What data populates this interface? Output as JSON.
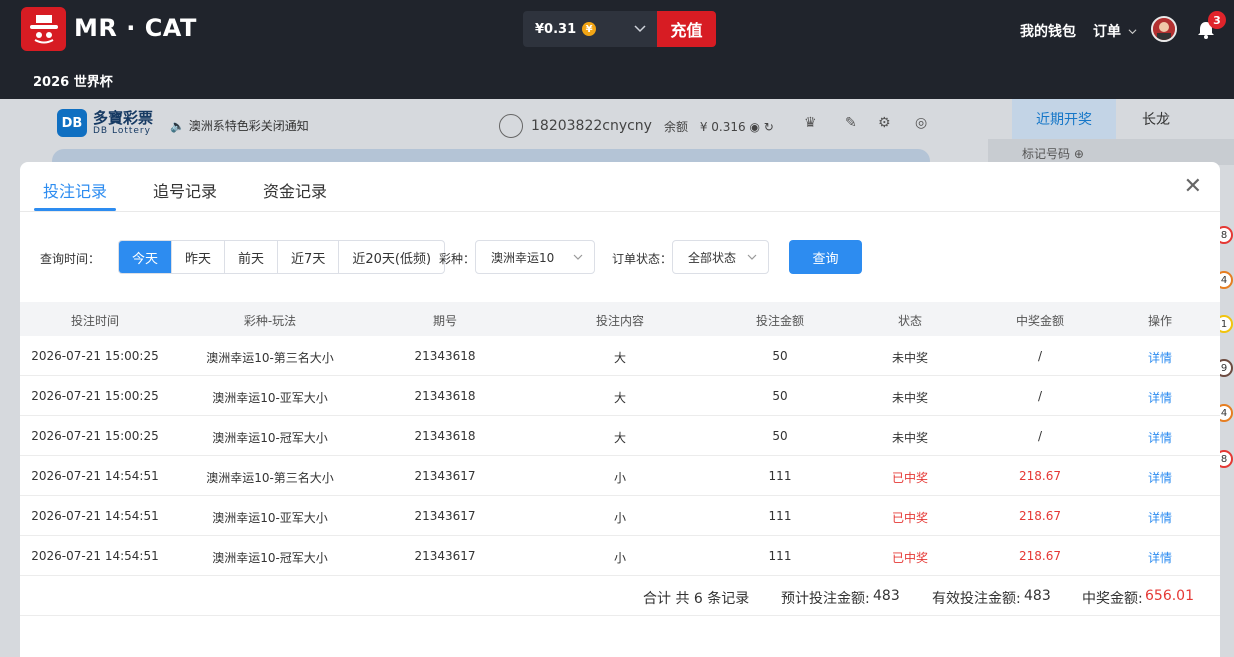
{
  "header": {
    "brand": "MR · CAT",
    "subtitle": "2026 世界杯",
    "balance": "¥0.31",
    "coin_symbol": "¥",
    "recharge": "充值",
    "wallet": "我的钱包",
    "orders": "订单",
    "notifications_count": "3"
  },
  "background": {
    "lottery_logo": "DB",
    "lottery_name": "多寶彩票",
    "lottery_sub": "DB Lottery",
    "notice": "澳洲系特色彩关闭通知",
    "username": "18203822cnycny",
    "balance_label": "余额",
    "balance_value": "¥ 0.316",
    "tab_recent": "近期开奖",
    "tab_long": "长龙",
    "mark_number": "标记号码",
    "balls": [
      "8",
      "4",
      "1",
      "9",
      "4",
      "8"
    ]
  },
  "modal": {
    "tabs": [
      "投注记录",
      "追号记录",
      "资金记录"
    ],
    "filters": {
      "time_label": "查询时间：",
      "time_options": [
        "今天",
        "昨天",
        "前天",
        "近7天",
        "近20天(低频)"
      ],
      "lottery_label": "彩种：",
      "lottery_value": "澳洲幸运10",
      "status_label": "订单状态：",
      "status_value": "全部状态",
      "query_button": "查询"
    },
    "columns": [
      "投注时间",
      "彩种-玩法",
      "期号",
      "投注内容",
      "投注金额",
      "状态",
      "中奖金额",
      "操作"
    ],
    "rows": [
      {
        "time": "2026-07-21 15:00:25",
        "game": "澳洲幸运10-第三名大小",
        "issue": "21343618",
        "content": "大",
        "amount": "50",
        "status": "未中奖",
        "win": "/",
        "action": "详情"
      },
      {
        "time": "2026-07-21 15:00:25",
        "game": "澳洲幸运10-亚军大小",
        "issue": "21343618",
        "content": "大",
        "amount": "50",
        "status": "未中奖",
        "win": "/",
        "action": "详情"
      },
      {
        "time": "2026-07-21 15:00:25",
        "game": "澳洲幸运10-冠军大小",
        "issue": "21343618",
        "content": "大",
        "amount": "50",
        "status": "未中奖",
        "win": "/",
        "action": "详情"
      },
      {
        "time": "2026-07-21 14:54:51",
        "game": "澳洲幸运10-第三名大小",
        "issue": "21343617",
        "content": "小",
        "amount": "111",
        "status": "已中奖",
        "win": "218.67",
        "action": "详情"
      },
      {
        "time": "2026-07-21 14:54:51",
        "game": "澳洲幸运10-亚军大小",
        "issue": "21343617",
        "content": "小",
        "amount": "111",
        "status": "已中奖",
        "win": "218.67",
        "action": "详情"
      },
      {
        "time": "2026-07-21 14:54:51",
        "game": "澳洲幸运10-冠军大小",
        "issue": "21343617",
        "content": "小",
        "amount": "111",
        "status": "已中奖",
        "win": "218.67",
        "action": "详情"
      }
    ],
    "summary": {
      "total": "合计 共 6 条记录",
      "expected_label": "预计投注金额:",
      "expected_value": "483",
      "valid_label": "有效投注金额:",
      "valid_value": "483",
      "win_label": "中奖金额:",
      "win_value": "656.01"
    }
  },
  "colors": {
    "brand_red": "#d71c23",
    "accent_blue": "#2d8cf0",
    "win_red": "#e53935",
    "topbar": "#20242c"
  }
}
